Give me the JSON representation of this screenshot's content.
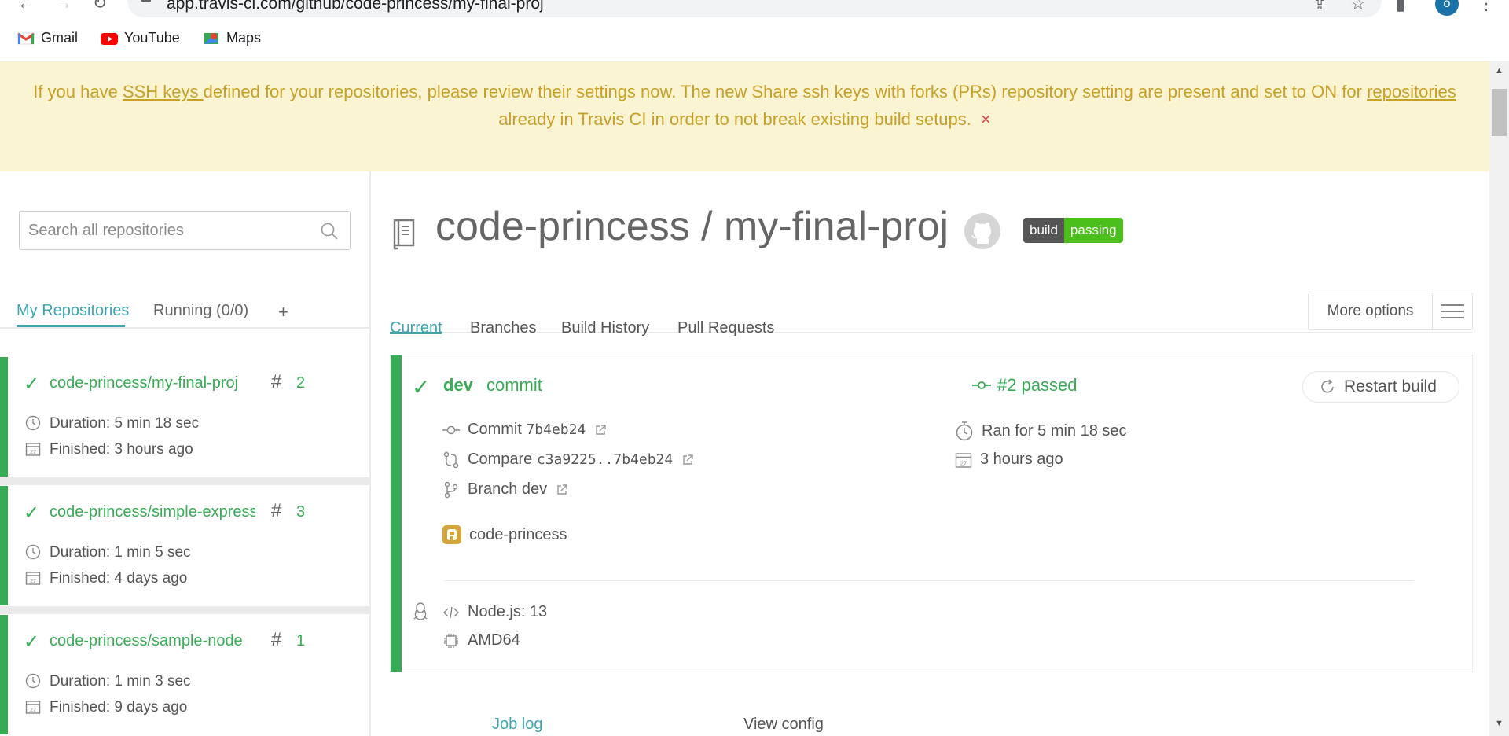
{
  "browser": {
    "url": "app.travis-ci.com/github/code-princess/my-final-proj",
    "profile_initial": "o",
    "bookmarks": [
      "Gmail",
      "YouTube",
      "Maps"
    ]
  },
  "banner": {
    "text_before": "If you have ",
    "link1": "SSH keys ",
    "text_middle": "defined for your repositories, please review their settings now. The new Share ssh keys with forks (PRs) repository setting are present and set to ON for ",
    "link2": "repositories",
    "text_after": " already in Travis CI in order to not break existing build setups.",
    "close_symbol": "×"
  },
  "sidebar": {
    "search_placeholder": "Search all repositories",
    "tabs": [
      "My Repositories",
      "Running (0/0)",
      "+"
    ],
    "repos": [
      {
        "name": "code-princess/my-final-proj",
        "number": "2",
        "duration": "Duration: 5 min 18 sec",
        "finished": "Finished: 3 hours ago"
      },
      {
        "name": "code-princess/simple-express",
        "number": "3",
        "duration": "Duration: 1 min 5 sec",
        "finished": "Finished: 4 days ago"
      },
      {
        "name": "code-princess/sample-node",
        "number": "1",
        "duration": "Duration: 1 min 3 sec",
        "finished": "Finished: 9 days ago"
      }
    ]
  },
  "main": {
    "title": "code-princess / my-final-proj",
    "badge_left": "build",
    "badge_right": "passing",
    "tabs": [
      "Current",
      "Branches",
      "Build History",
      "Pull Requests"
    ],
    "more_options": "More options",
    "build": {
      "branch": "dev",
      "event": "commit",
      "status": "#2 passed",
      "restart": "Restart build",
      "commit_label": "Commit",
      "commit_sha": "7b4eb24",
      "compare_label": "Compare",
      "compare_range": "c3a9225..7b4eb24",
      "branch_label": "Branch dev",
      "author": "code-princess",
      "ran_for": "Ran for 5 min 18 sec",
      "ago": "3 hours ago",
      "language": "Node.js: 13",
      "arch": "AMD64"
    },
    "bottom_tabs": [
      "Job log",
      "View config"
    ]
  },
  "colors": {
    "accent": "#3fa4ad",
    "passed": "#39aa56",
    "banner_bg": "#faf4d3",
    "banner_text": "#c8a028"
  }
}
